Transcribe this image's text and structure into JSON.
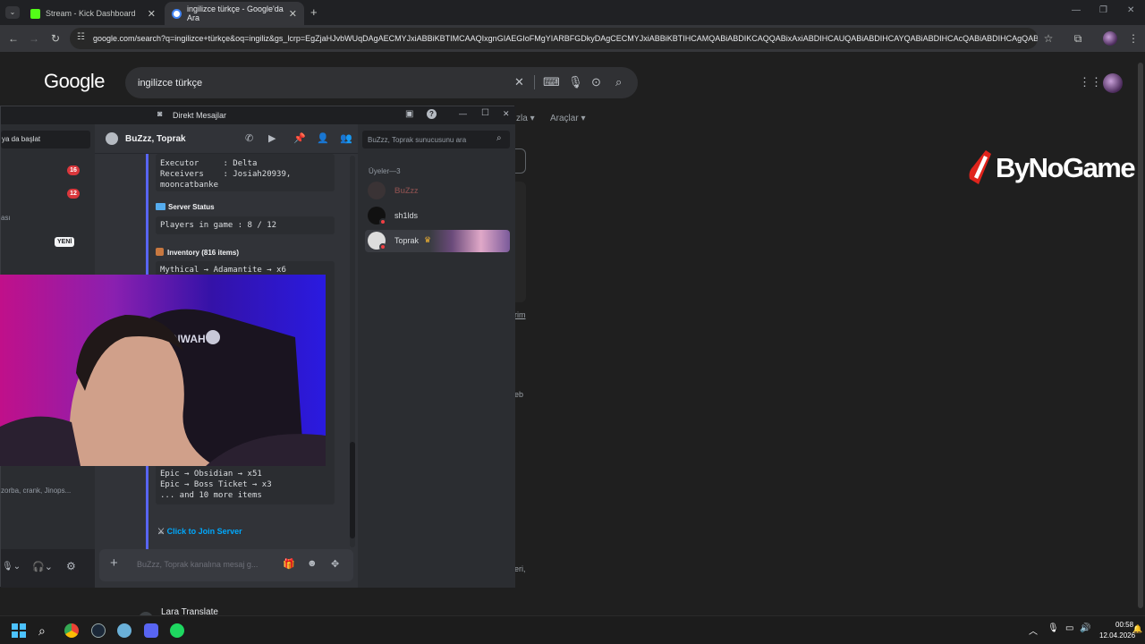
{
  "browser": {
    "tabs": [
      {
        "title": "Stream - Kick Dashboard",
        "active": false
      },
      {
        "title": "ingilizce türkçe - Google'da Ara",
        "active": true
      }
    ],
    "url": "google.com/search?q=ingilizce+türkçe&oq=ingiliz&gs_lcrp=EgZjaHJvbWUqDAgAECMYJxiABBiKBTIMCAAQIxgnGIAEGIoFMgYIARBFGDkyDAgCECMYJxiABBiKBTIHCAMQABiABDIKCAQQABixAxiABDIHCAUQABiABDIHCAYQABiABDIHCAcQABiABDIHCAgQABi..."
  },
  "google": {
    "logo": "Google",
    "query": "ingilizce türkçe",
    "tools_label": "Araçlar",
    "partial_tab": "zla",
    "fragments": {
      "a": "rim",
      "b": "eb",
      "c": "eri,"
    },
    "bottom_result": "Lara Translate"
  },
  "ad": {
    "brand": "ByNoGame"
  },
  "discord": {
    "window_title": "Direkt Mesajlar",
    "left": {
      "search_hint": "ya da başlat",
      "badge1": "16",
      "badge2": "12",
      "item_asi": "ası",
      "new_badge": "YENİ",
      "names_line": "zorba, crank, Jinops..."
    },
    "chat": {
      "header": "BuZzz, Toprak",
      "search_placeholder": "BuZzz, Toprak sunucusunu ara",
      "code1": "Executor     : Delta\nReceivers    : Josiah20939,\nmooncatbanke",
      "server_status_title": "Server Status",
      "players_line": "Players in game : 8 / 12",
      "inventory_title": "Inventory (816 items)",
      "inventory_first": "Mythical → Adamantite → x6",
      "inventory_rest": "Epic → Obsidian → x51\nEpic → Boss Ticket → x3\n... and 10 more items",
      "join_link": "Click to Join Server",
      "message_placeholder": "BuZzz, Toprak kanalına mesaj g..."
    },
    "members": {
      "header": "Üyeler—3",
      "list": [
        {
          "name": "BuZzz",
          "color": "#7a4a4a"
        },
        {
          "name": "sh1lds",
          "color": "#dbdee1"
        },
        {
          "name": "Toprak",
          "color": "#dbdee1"
        }
      ]
    }
  },
  "taskbar": {
    "time": "00:58",
    "date": "12.04.2026"
  },
  "colors": {
    "blurple": "#5865f2",
    "discord_bg": "#313338",
    "google_bg": "#1f1f1f",
    "bng_red": "#e0241c"
  }
}
